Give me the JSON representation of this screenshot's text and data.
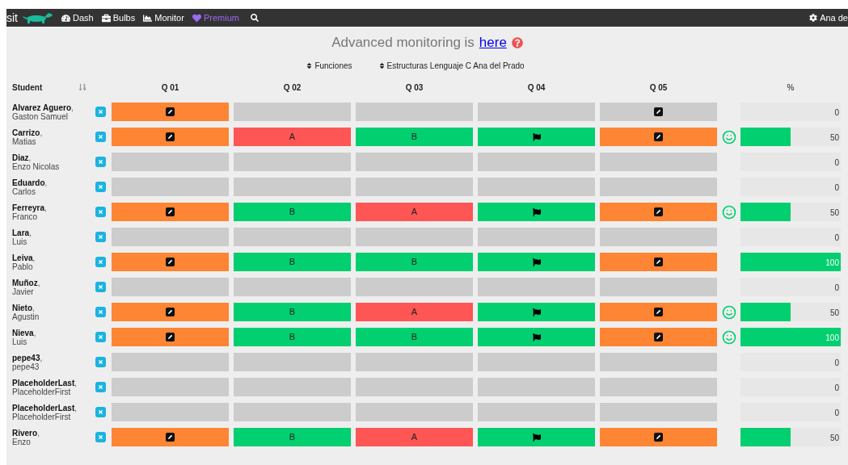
{
  "navbar": {
    "brand": "sit",
    "items": [
      {
        "kind": "dash",
        "label": "Dash"
      },
      {
        "kind": "bulbs",
        "label": "Bulbs"
      },
      {
        "kind": "monitor",
        "label": "Monitor"
      },
      {
        "kind": "premium",
        "label": "Premium"
      }
    ],
    "user": "Ana de"
  },
  "banner": {
    "text": "Advanced monitoring is",
    "link": "here"
  },
  "filters": [
    "Funciones",
    "Estructuras Lenguaje C Ana del Prado"
  ],
  "table": {
    "student_header": "Student",
    "question_headers": [
      "Q 01",
      "Q 02",
      "Q 03",
      "Q 04",
      "Q 05"
    ],
    "percent_header": "%",
    "rows": [
      {
        "name": "**Alvarez Aguero**,",
        "first": "Gaston Samuel",
        "cells": [
          {
            "kind": "submitted"
          },
          {
            "kind": "empty"
          },
          {
            "kind": "empty"
          },
          {
            "kind": "empty"
          },
          {
            "kind": "started"
          }
        ],
        "smiley": false,
        "score": "0"
      },
      {
        "name": "**Carrizo**,",
        "first": "Matias",
        "cells": [
          {
            "kind": "submitted"
          },
          {
            "kind": "incorrect",
            "text": "A"
          },
          {
            "kind": "correct",
            "text": "B"
          },
          {
            "kind": "flagged"
          },
          {
            "kind": "submitted"
          }
        ],
        "smiley": true,
        "level": 0.5,
        "score": "50"
      },
      {
        "name": "**Diaz**,",
        "first": "Enzo Nicolas",
        "cells": [
          {
            "kind": "empty"
          },
          {
            "kind": "empty"
          },
          {
            "kind": "empty"
          },
          {
            "kind": "empty"
          },
          {
            "kind": "empty"
          }
        ],
        "smiley": false,
        "score": "0"
      },
      {
        "name": "**Eduardo**,",
        "first": "Carlos",
        "cells": [
          {
            "kind": "empty"
          },
          {
            "kind": "empty"
          },
          {
            "kind": "empty"
          },
          {
            "kind": "empty"
          },
          {
            "kind": "empty"
          }
        ],
        "smiley": false,
        "score": "0"
      },
      {
        "name": "**Ferreyra**,",
        "first": "Franco",
        "cells": [
          {
            "kind": "submitted"
          },
          {
            "kind": "correct",
            "text": "B"
          },
          {
            "kind": "incorrect",
            "text": "A"
          },
          {
            "kind": "flagged"
          },
          {
            "kind": "submitted"
          }
        ],
        "smiley": true,
        "level": 0.5,
        "score": "50"
      },
      {
        "name": "**Lara**,",
        "first": "Luis",
        "cells": [
          {
            "kind": "empty"
          },
          {
            "kind": "empty"
          },
          {
            "kind": "empty"
          },
          {
            "kind": "empty"
          },
          {
            "kind": "empty"
          }
        ],
        "smiley": false,
        "score": "0"
      },
      {
        "name": "**Leiva**,",
        "first": "Pablo",
        "cells": [
          {
            "kind": "submitted"
          },
          {
            "kind": "correct",
            "text": "B"
          },
          {
            "kind": "correct",
            "text": "B"
          },
          {
            "kind": "flagged"
          },
          {
            "kind": "submitted"
          }
        ],
        "smiley": false,
        "level": 1,
        "score": "100"
      },
      {
        "name": "**Muñoz**,",
        "first": "Javier",
        "cells": [
          {
            "kind": "empty"
          },
          {
            "kind": "empty"
          },
          {
            "kind": "empty"
          },
          {
            "kind": "empty"
          },
          {
            "kind": "empty"
          }
        ],
        "smiley": false,
        "score": "0"
      },
      {
        "name": "**Nieto**,",
        "first": "Agustin",
        "cells": [
          {
            "kind": "submitted"
          },
          {
            "kind": "correct",
            "text": "B"
          },
          {
            "kind": "incorrect",
            "text": "A"
          },
          {
            "kind": "flagged"
          },
          {
            "kind": "submitted"
          }
        ],
        "smiley": true,
        "level": 0.5,
        "score": "50"
      },
      {
        "name": "**Nieva**,",
        "first": "Luis",
        "cells": [
          {
            "kind": "submitted"
          },
          {
            "kind": "correct",
            "text": "B"
          },
          {
            "kind": "correct",
            "text": "B"
          },
          {
            "kind": "flagged"
          },
          {
            "kind": "submitted"
          }
        ],
        "smiley": true,
        "level": 1,
        "score": "100"
      },
      {
        "name": "**pepe43**,",
        "first": "pepe43",
        "cells": [
          {
            "kind": "empty"
          },
          {
            "kind": "empty"
          },
          {
            "kind": "empty"
          },
          {
            "kind": "empty"
          },
          {
            "kind": "empty"
          }
        ],
        "smiley": false,
        "score": "0"
      },
      {
        "name": "**PlaceholderLast**,",
        "first": "PlaceholderFirst",
        "cells": [
          {
            "kind": "empty"
          },
          {
            "kind": "empty"
          },
          {
            "kind": "empty"
          },
          {
            "kind": "empty"
          },
          {
            "kind": "empty"
          }
        ],
        "smiley": false,
        "score": "0"
      },
      {
        "name": "**PlaceholderLast**,",
        "first": "PlaceholderFirst",
        "cells": [
          {
            "kind": "empty"
          },
          {
            "kind": "empty"
          },
          {
            "kind": "empty"
          },
          {
            "kind": "empty"
          },
          {
            "kind": "empty"
          }
        ],
        "smiley": false,
        "score": "0"
      },
      {
        "name": "**Rivero**,",
        "first": "Enzo",
        "cells": [
          {
            "kind": "submitted"
          },
          {
            "kind": "correct",
            "text": "B"
          },
          {
            "kind": "incorrect",
            "text": "A"
          },
          {
            "kind": "flagged"
          },
          {
            "kind": "submitted"
          }
        ],
        "smiley": false,
        "level": 0.5,
        "score": "50"
      }
    ]
  }
}
